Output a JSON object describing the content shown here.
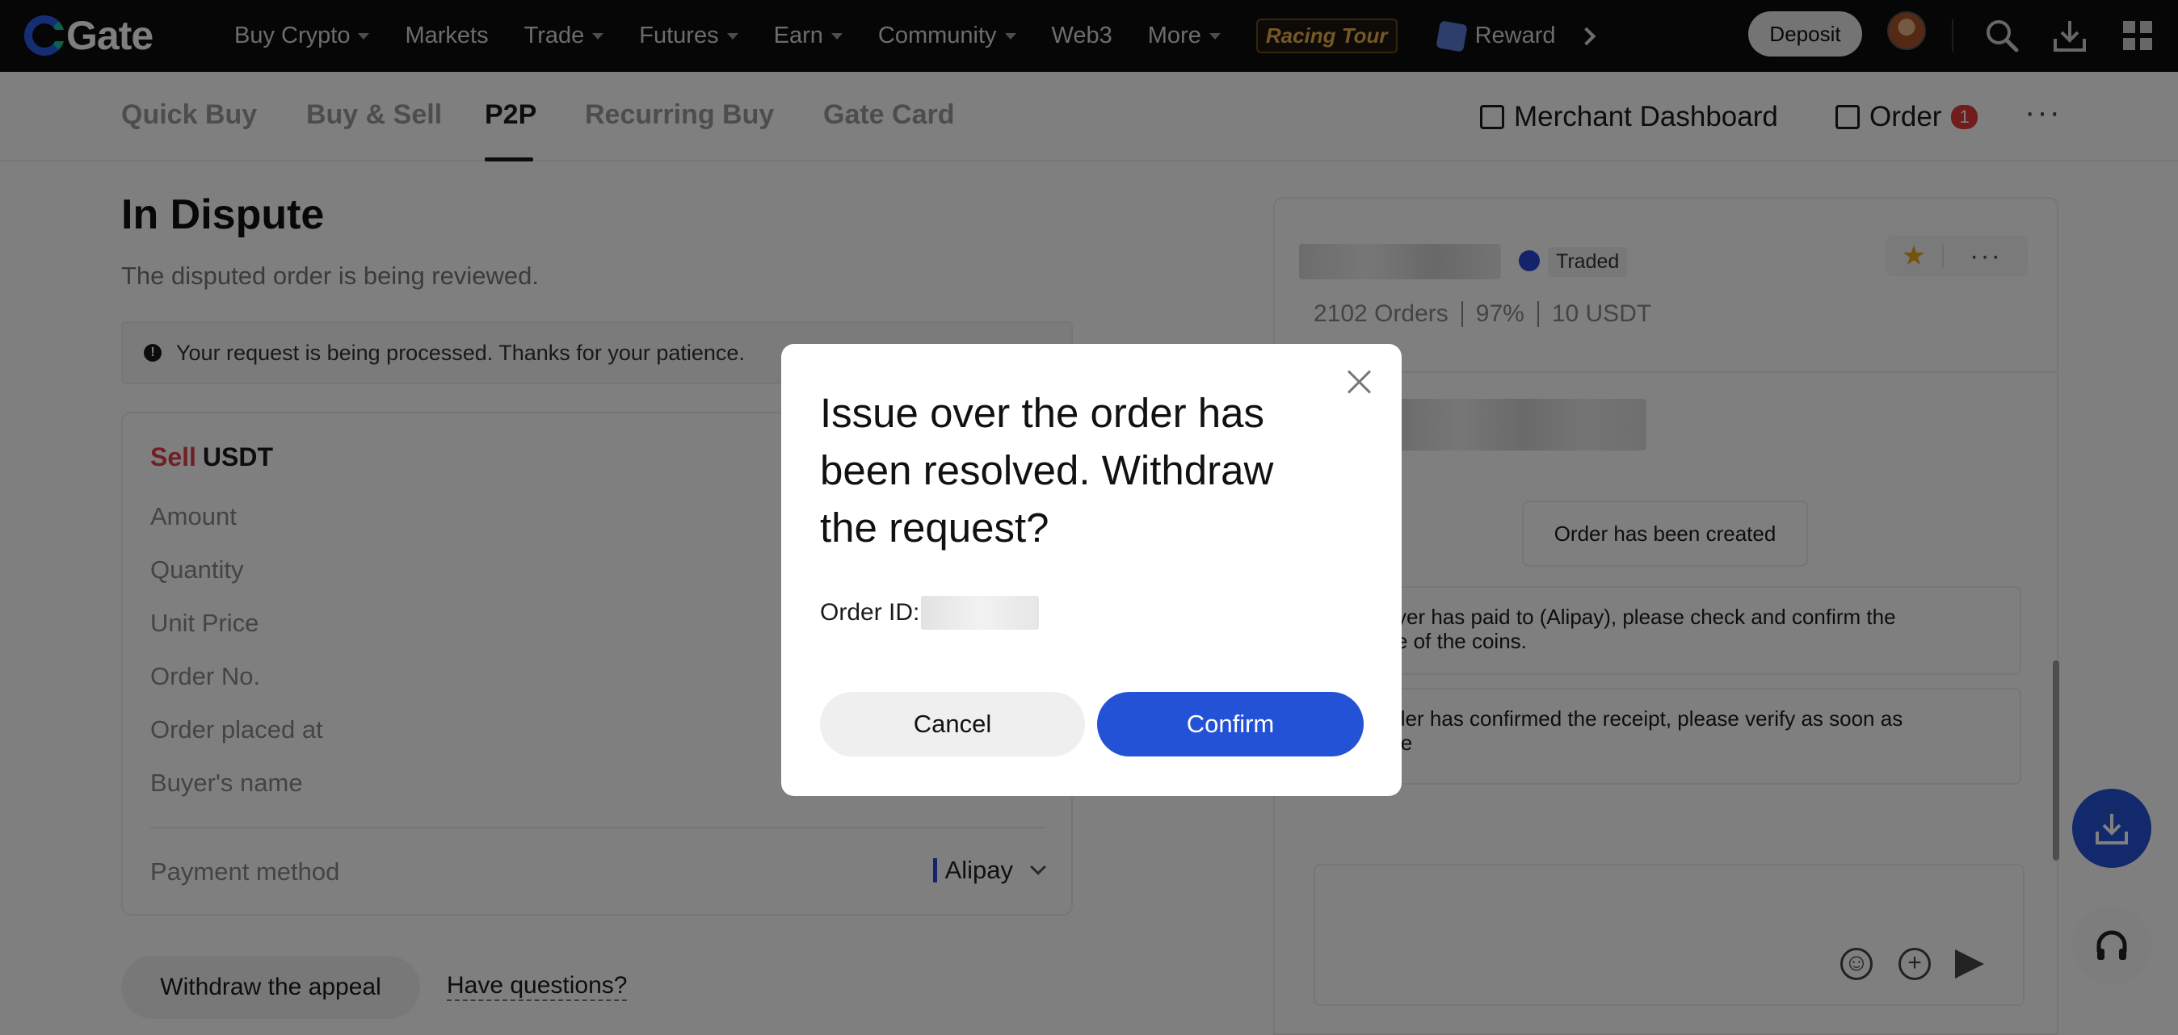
{
  "topnav": {
    "logo_text": "Gate",
    "items": [
      {
        "label": "Buy Crypto",
        "has_caret": true
      },
      {
        "label": "Markets",
        "has_caret": false
      },
      {
        "label": "Trade",
        "has_caret": true
      },
      {
        "label": "Futures",
        "has_caret": true
      },
      {
        "label": "Earn",
        "has_caret": true
      },
      {
        "label": "Community",
        "has_caret": true
      },
      {
        "label": "Web3",
        "has_caret": false
      },
      {
        "label": "More",
        "has_caret": true
      }
    ],
    "promo_label": "Racing Tour",
    "reward_label": "Reward",
    "deposit_label": "Deposit",
    "icons": [
      "search-icon",
      "download-icon",
      "apps-grid-icon"
    ]
  },
  "subnav": {
    "tabs": [
      "Quick Buy",
      "Buy & Sell",
      "P2P",
      "Recurring Buy",
      "Gate Card"
    ],
    "active_tab": "P2P",
    "merchant_label": "Merchant Dashboard",
    "order_label": "Order",
    "order_badge": "1"
  },
  "dispute": {
    "title": "In Dispute",
    "subtitle": "The disputed order is being reviewed.",
    "notice": "Your request is being processed. Thanks for your patience.",
    "card": {
      "side": "Sell",
      "asset": "USDT",
      "fields": [
        "Amount",
        "Quantity",
        "Unit Price",
        "Order No.",
        "Order placed at",
        "Buyer's name"
      ],
      "payment_label": "Payment method",
      "payment_value": "Alipay"
    },
    "withdraw_label": "Withdraw the appeal",
    "questions_label": "Have questions?"
  },
  "chat": {
    "badge": "Traded",
    "stats": [
      "2102 Orders",
      "97%",
      "10 USDT"
    ],
    "system_created": "Order has been created",
    "msg_paid": "yer has paid to (Alipay), please check and confirm the\ne of the coins.",
    "msg_confirmed": "ller has confirmed the receipt, please verify as soon as\nle"
  },
  "modal": {
    "title": "Issue over the order has been resolved. Withdraw the request?",
    "order_id_label": "Order ID:",
    "cancel_label": "Cancel",
    "confirm_label": "Confirm"
  },
  "colors": {
    "accent": "#2452d6",
    "sell": "#e0404a",
    "topnav_bg": "#0c0d0f",
    "badge": "#e23a3a"
  }
}
